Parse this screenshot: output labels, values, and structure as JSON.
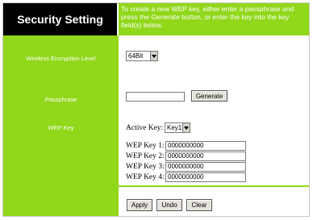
{
  "header": {
    "title": "Security Setting",
    "description": "To create a new WEP key, either enter a passphrase and press the Generate button, or enter the key into the key field(s) below."
  },
  "encryption": {
    "label": "Wireless Encryption Level",
    "selected": "64Bit"
  },
  "passphrase": {
    "label": "Passphrase",
    "value": "",
    "generate_label": "Generate"
  },
  "wep": {
    "label": "WEP Key",
    "active_key_label": "Active Key:",
    "active_key_selected": "Key1",
    "keys": [
      {
        "label": "WEP Key 1:",
        "value": "0000000000"
      },
      {
        "label": "WEP Key 2:",
        "value": "0000000000"
      },
      {
        "label": "WEP Key 3:",
        "value": "0000000000"
      },
      {
        "label": "WEP Key 4:",
        "value": "0000000000"
      }
    ]
  },
  "footer": {
    "apply_label": "Apply",
    "undo_label": "Undo",
    "clear_label": "Clear"
  },
  "colors": {
    "accent": "#91d71a",
    "title_bg": "#000000"
  }
}
